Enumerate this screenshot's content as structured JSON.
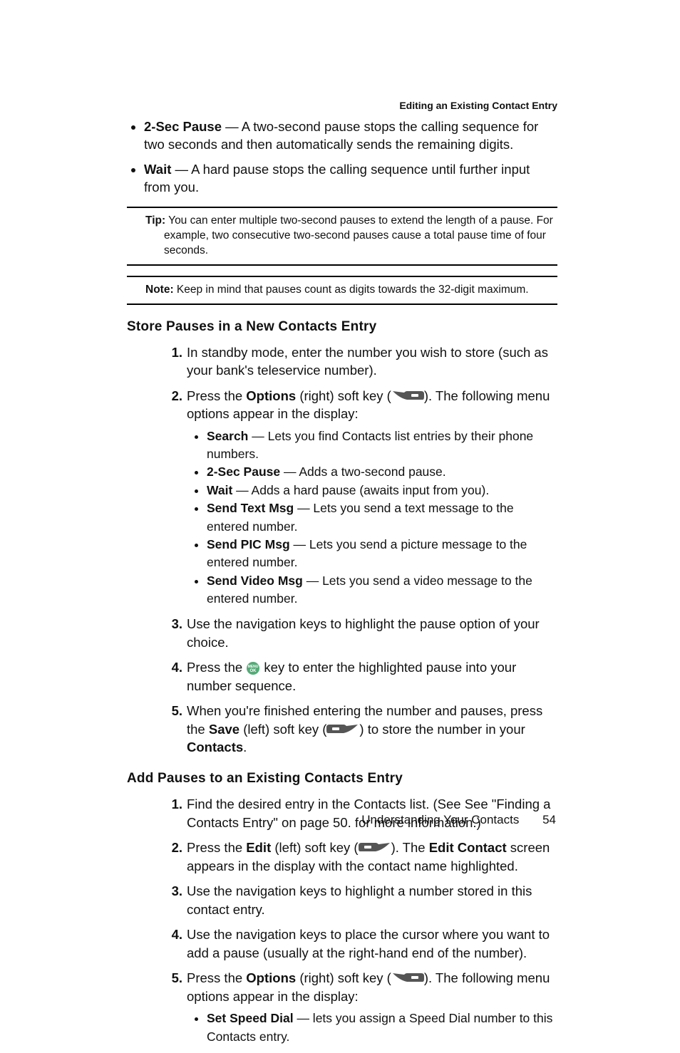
{
  "header": "Editing an Existing Contact Entry",
  "topBullets": [
    {
      "term": "2-Sec Pause",
      "text": " — A two-second pause stops the calling sequence for two seconds and then automatically sends the remaining digits."
    },
    {
      "term": "Wait",
      "text": " — A hard pause stops the calling sequence until further input from you."
    }
  ],
  "tip": {
    "label": "Tip:",
    "text": " You can enter multiple two-second pauses to extend the length of a pause. For example, two consecutive two-second pauses cause a total pause time of four seconds."
  },
  "note": {
    "label": "Note:",
    "text": " Keep in mind that pauses count as digits towards the 32-digit maximum."
  },
  "sectionA": {
    "title": "Store Pauses in a New Contacts Entry",
    "step1": "In standby mode, enter the number you wish to store (such as your bank's teleservice number).",
    "step2a": "Press the ",
    "step2b": "Options",
    "step2c": " (right) soft key (",
    "step2d": "). The following menu options appear in the display:",
    "opts": [
      {
        "term": "Search",
        "text": " — Lets you find Contacts list entries by their phone numbers."
      },
      {
        "term": "2-Sec Pause",
        "text": " — Adds a two-second pause."
      },
      {
        "term": "Wait",
        "text": " — Adds a hard pause (awaits input from you)."
      },
      {
        "term": "Send Text Msg",
        "text": " — Lets you send a text message to the entered number."
      },
      {
        "term": "Send PIC Msg",
        "text": " — Lets you send a picture message to the entered number."
      },
      {
        "term": "Send Video Msg",
        "text": " — Lets you send a video message to the entered number."
      }
    ],
    "step3": "Use the navigation keys to highlight the pause option of your choice.",
    "step4a": "Press the ",
    "step4b": " key to enter the highlighted pause into your number sequence.",
    "step5a": "When you're finished entering the number and pauses, press the ",
    "step5b": "Save",
    "step5c": " (left) soft key (",
    "step5d": ") to store the number in your ",
    "step5e": "Contacts",
    "step5f": "."
  },
  "sectionB": {
    "title": "Add Pauses to an Existing Contacts Entry",
    "step1": "Find the desired entry in the Contacts list. (See See \"Finding a Contacts Entry\" on page 50. for more information.)",
    "step2a": "Press the ",
    "step2b": "Edit",
    "step2c": " (left) soft key (",
    "step2d": "). The ",
    "step2e": "Edit Contact",
    "step2f": " screen appears in the display with the contact name highlighted.",
    "step3": "Use the navigation keys to highlight a number stored in this contact entry.",
    "step4": "Use the navigation keys to place the cursor where you want to add a pause (usually at the right-hand end of the number).",
    "step5a": "Press the ",
    "step5b": "Options",
    "step5c": " (right) soft key (",
    "step5d": "). The following menu options appear in the display:",
    "opts": [
      {
        "term": "Set Speed Dial",
        "text": " — lets you assign a Speed Dial number to this Contacts entry."
      }
    ]
  },
  "footer": {
    "section": "Understanding Your Contacts",
    "page": "54"
  }
}
